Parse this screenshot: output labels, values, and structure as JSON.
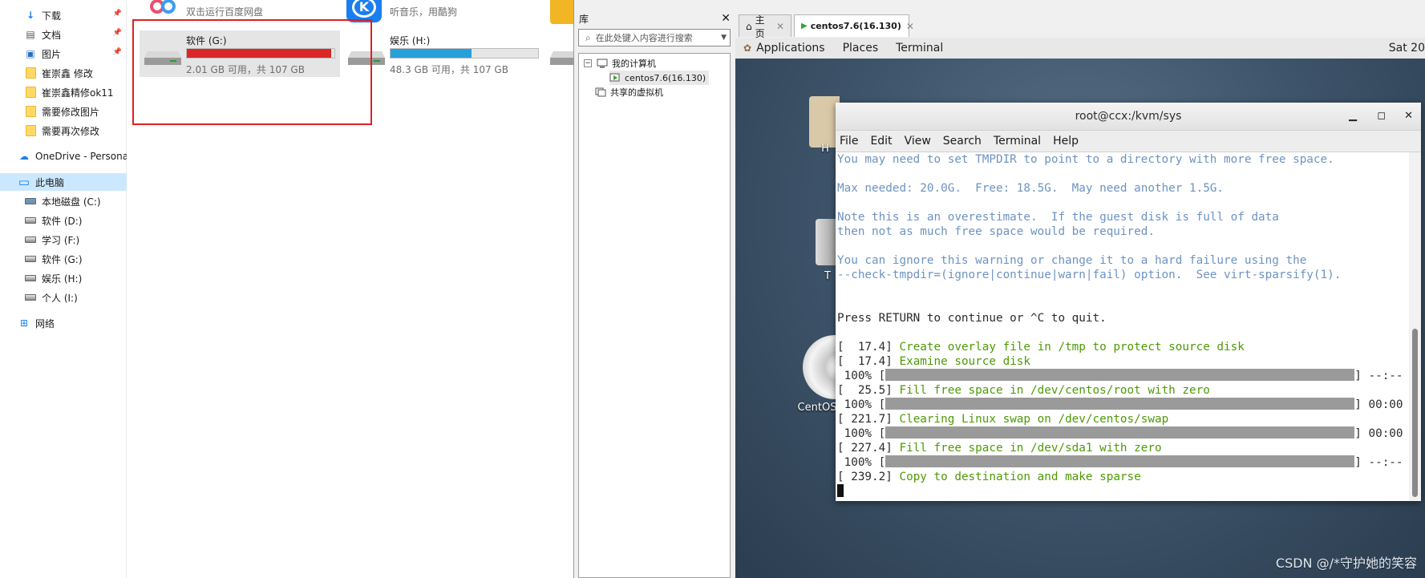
{
  "explorer": {
    "nav": [
      {
        "label": "下载",
        "icon": "download-icon",
        "pinned": true
      },
      {
        "label": "文档",
        "icon": "document-icon",
        "pinned": true
      },
      {
        "label": "图片",
        "icon": "picture-icon",
        "pinned": true
      },
      {
        "label": "崔崇鑫 修改",
        "icon": "folder-icon",
        "pinned": false
      },
      {
        "label": "崔崇鑫精修ok11",
        "icon": "folder-icon",
        "pinned": false
      },
      {
        "label": "需要修改图片",
        "icon": "folder-icon",
        "pinned": false
      },
      {
        "label": "需要再次修改",
        "icon": "folder-icon",
        "pinned": false
      },
      {
        "label": "OneDrive - Persona",
        "icon": "cloud-icon",
        "pinned": false
      },
      {
        "label": "此电脑",
        "icon": "computer-icon",
        "pinned": false,
        "selected": true
      },
      {
        "label": "本地磁盘 (C:)",
        "icon": "windows-drive-icon",
        "pinned": false
      },
      {
        "label": "软件 (D:)",
        "icon": "drive-icon",
        "pinned": false
      },
      {
        "label": "学习 (F:)",
        "icon": "drive-icon",
        "pinned": false
      },
      {
        "label": "软件 (G:)",
        "icon": "drive-icon",
        "pinned": false
      },
      {
        "label": "娱乐 (H:)",
        "icon": "drive-icon",
        "pinned": false
      },
      {
        "label": "个人 (I:)",
        "icon": "drive-icon",
        "pinned": false
      },
      {
        "label": "网络",
        "icon": "network-icon",
        "pinned": false
      }
    ],
    "baidu_subtitle": "双击运行百度网盘",
    "kugou_subtitle": "听音乐，用酷狗",
    "drives": [
      {
        "name": "软件 (G:)",
        "info": "2.01 GB 可用，共 107 GB",
        "used_fraction": 0.98,
        "bar_color": "#da2626",
        "selected": true
      },
      {
        "name": "娱乐 (H:)",
        "info": "48.3 GB 可用，共 107 GB",
        "used_fraction": 0.55,
        "bar_color": "#26a0da",
        "selected": false
      }
    ]
  },
  "library": {
    "title": "库",
    "search_placeholder": "在此处键入内容进行搜索",
    "tree": [
      {
        "label": "我的计算机"
      },
      {
        "label": "centos7.6(16.130)"
      },
      {
        "label": "共享的虚拟机"
      }
    ]
  },
  "vm": {
    "tabs": [
      {
        "label": "主页"
      },
      {
        "label": "centos7.6(16.130)"
      }
    ],
    "gnome": {
      "applications": "Applications",
      "places": "Places",
      "terminal": "Terminal",
      "clock": "Sat 20"
    },
    "desktop_labels": [
      "H",
      "T",
      "CentOS"
    ],
    "terminal": {
      "title": "root@ccx:/kvm/sys",
      "menu": [
        "File",
        "Edit",
        "View",
        "Search",
        "Terminal",
        "Help"
      ],
      "warning_lines": [
        "You may need to set TMPDIR to point to a directory with more free space.",
        "",
        "Max needed: 20.0G.  Free: 18.5G.  May need another 1.5G.",
        "",
        "Note this is an overestimate.  If the guest disk is full of data",
        "then not as much free space would be required.",
        "",
        "You can ignore this warning or change it to a hard failure using the",
        "--check-tmpdir=(ignore|continue|warn|fail) option.  See virt-sparsify(1)."
      ],
      "prompt": "Press RETURN to continue or ^C to quit.",
      "steps": [
        {
          "time": "[  17.4]",
          "msg": "Create overlay file in /tmp to protect source disk"
        },
        {
          "time": "[  17.4]",
          "msg": "Examine source disk",
          "progress": " 100% [",
          "eta": "] --:--"
        },
        {
          "time": "[  25.5]",
          "msg": "Fill free space in /dev/centos/root with zero",
          "progress": " 100% [",
          "eta": "] 00:00"
        },
        {
          "time": "[ 221.7]",
          "msg": "Clearing Linux swap on /dev/centos/swap",
          "progress": " 100% [",
          "eta": "] 00:00"
        },
        {
          "time": "[ 227.4]",
          "msg": "Fill free space in /dev/sda1 with zero",
          "progress": " 100% [",
          "eta": "] --:--"
        },
        {
          "time": "[ 239.2]",
          "msg": "Copy to destination and make sparse"
        }
      ]
    },
    "watermark": "CSDN @/*守护她的笑容"
  }
}
